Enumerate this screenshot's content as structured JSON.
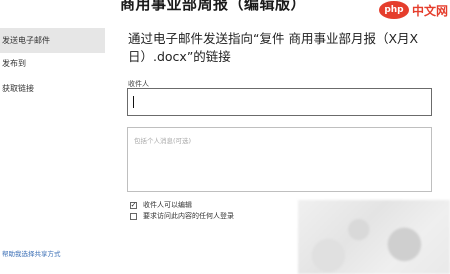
{
  "window": {
    "title": "商用事业部周报（编辑版）"
  },
  "watermark": {
    "logo": "php",
    "text": "中文网"
  },
  "sidebar": {
    "items": [
      {
        "label": "发送电子邮件",
        "active": true
      },
      {
        "label": "发布到",
        "active": false
      },
      {
        "label": "获取链接",
        "active": false
      }
    ],
    "help_link": "帮助我选择共享方式"
  },
  "main": {
    "heading": "通过电子邮件发送指向“复件 商用事业部月报（X月X日）.docx”的链接",
    "recipient_label": "收件人",
    "recipient_value": "",
    "message_placeholder": "包括个人消息(可选)",
    "checkboxes": [
      {
        "label": "收件人可以编辑",
        "checked": true
      },
      {
        "label": "要求访问此内容的任何人登录",
        "checked": false
      }
    ]
  },
  "colors": {
    "accent": "#e53d2c",
    "link": "#3b6fb6",
    "active_bg": "#e6e6e6"
  }
}
